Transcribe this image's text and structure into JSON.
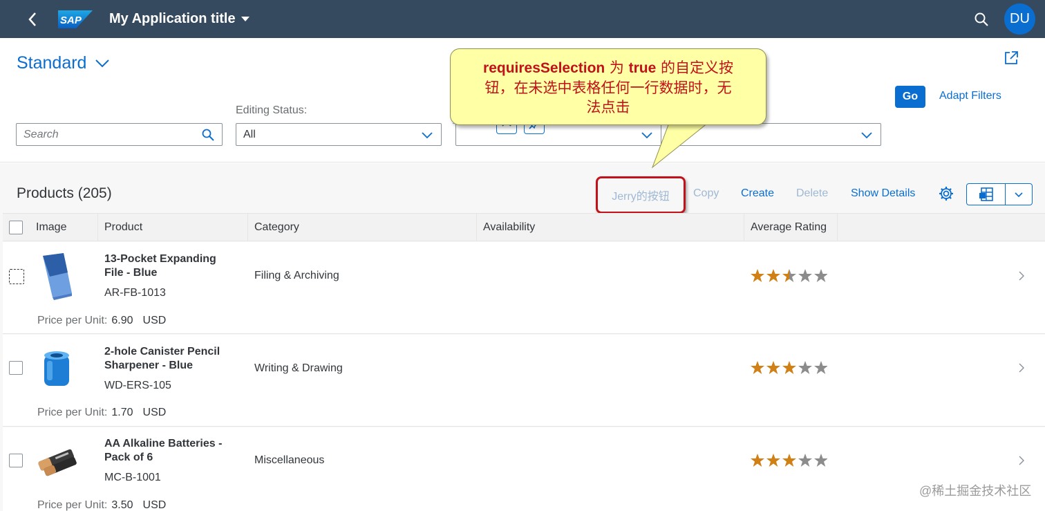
{
  "shell": {
    "logo_text": "SAP",
    "title": "My Application title",
    "avatar": "DU"
  },
  "header": {
    "variant": "Standard",
    "search_placeholder": "Search",
    "editing_status_label": "Editing Status:",
    "editing_status_value": "All",
    "go": "Go",
    "adapt_filters": "Adapt Filters"
  },
  "callout": {
    "line1_prefix": "requiresSelection",
    "line1_mid": " 为 ",
    "line1_bold2": "true",
    "line1_suffix": " 的自定义按",
    "line2": "钮，在未选中表格任何一行数据时，无",
    "line3": "法点击"
  },
  "table": {
    "title": "Products (205)",
    "toolbar": {
      "custom": "Jerry的按钮",
      "copy": "Copy",
      "create": "Create",
      "delete": "Delete",
      "show_details": "Show Details"
    },
    "columns": [
      "Image",
      "Product",
      "Category",
      "Availability",
      "Average Rating"
    ],
    "price_label": "Price per Unit:",
    "rows": [
      {
        "name": "13-Pocket Expanding File - Blue",
        "id": "AR-FB-1013",
        "category": "Filing & Archiving",
        "price": "6.90",
        "currency": "USD",
        "rating": 2.5,
        "image": "file-box-icon"
      },
      {
        "name": "2-hole Canister Pencil Sharpener - Blue",
        "id": "WD-ERS-105",
        "category": "Writing & Drawing",
        "price": "1.70",
        "currency": "USD",
        "rating": 3,
        "image": "sharpener-icon"
      },
      {
        "name": "AA Alkaline Batteries - Pack of 6",
        "id": "MC-B-1001",
        "category": "Miscellaneous",
        "price": "3.50",
        "currency": "USD",
        "rating": 3,
        "image": "batteries-icon"
      }
    ]
  },
  "colors": {
    "shell": "#354a5f",
    "accent": "#0a6ed1",
    "star_filled": "#d08014",
    "star_empty": "#8c8c8c",
    "callout_bg": "#ffffa5",
    "callout_text": "#c0121a"
  },
  "watermark": "@稀土掘金技术社区"
}
